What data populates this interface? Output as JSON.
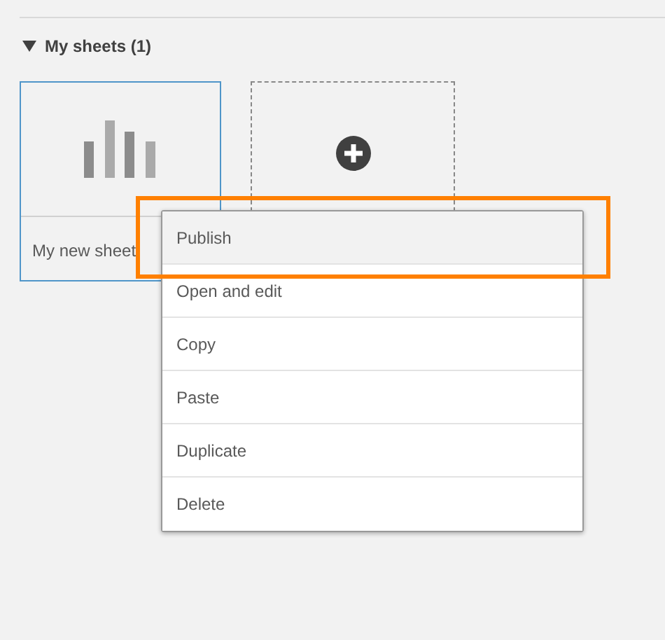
{
  "section": {
    "title": "My sheets (1)",
    "expanded": true
  },
  "sheets": [
    {
      "kind": "sheet",
      "title": "My new sheet",
      "selected": true
    },
    {
      "kind": "create"
    }
  ],
  "context_menu": {
    "items": [
      {
        "label": "Publish",
        "selected": true
      },
      {
        "label": "Open and edit",
        "selected": false
      },
      {
        "label": "Copy",
        "selected": false
      },
      {
        "label": "Paste",
        "selected": false
      },
      {
        "label": "Duplicate",
        "selected": false
      },
      {
        "label": "Delete",
        "selected": false
      }
    ]
  }
}
